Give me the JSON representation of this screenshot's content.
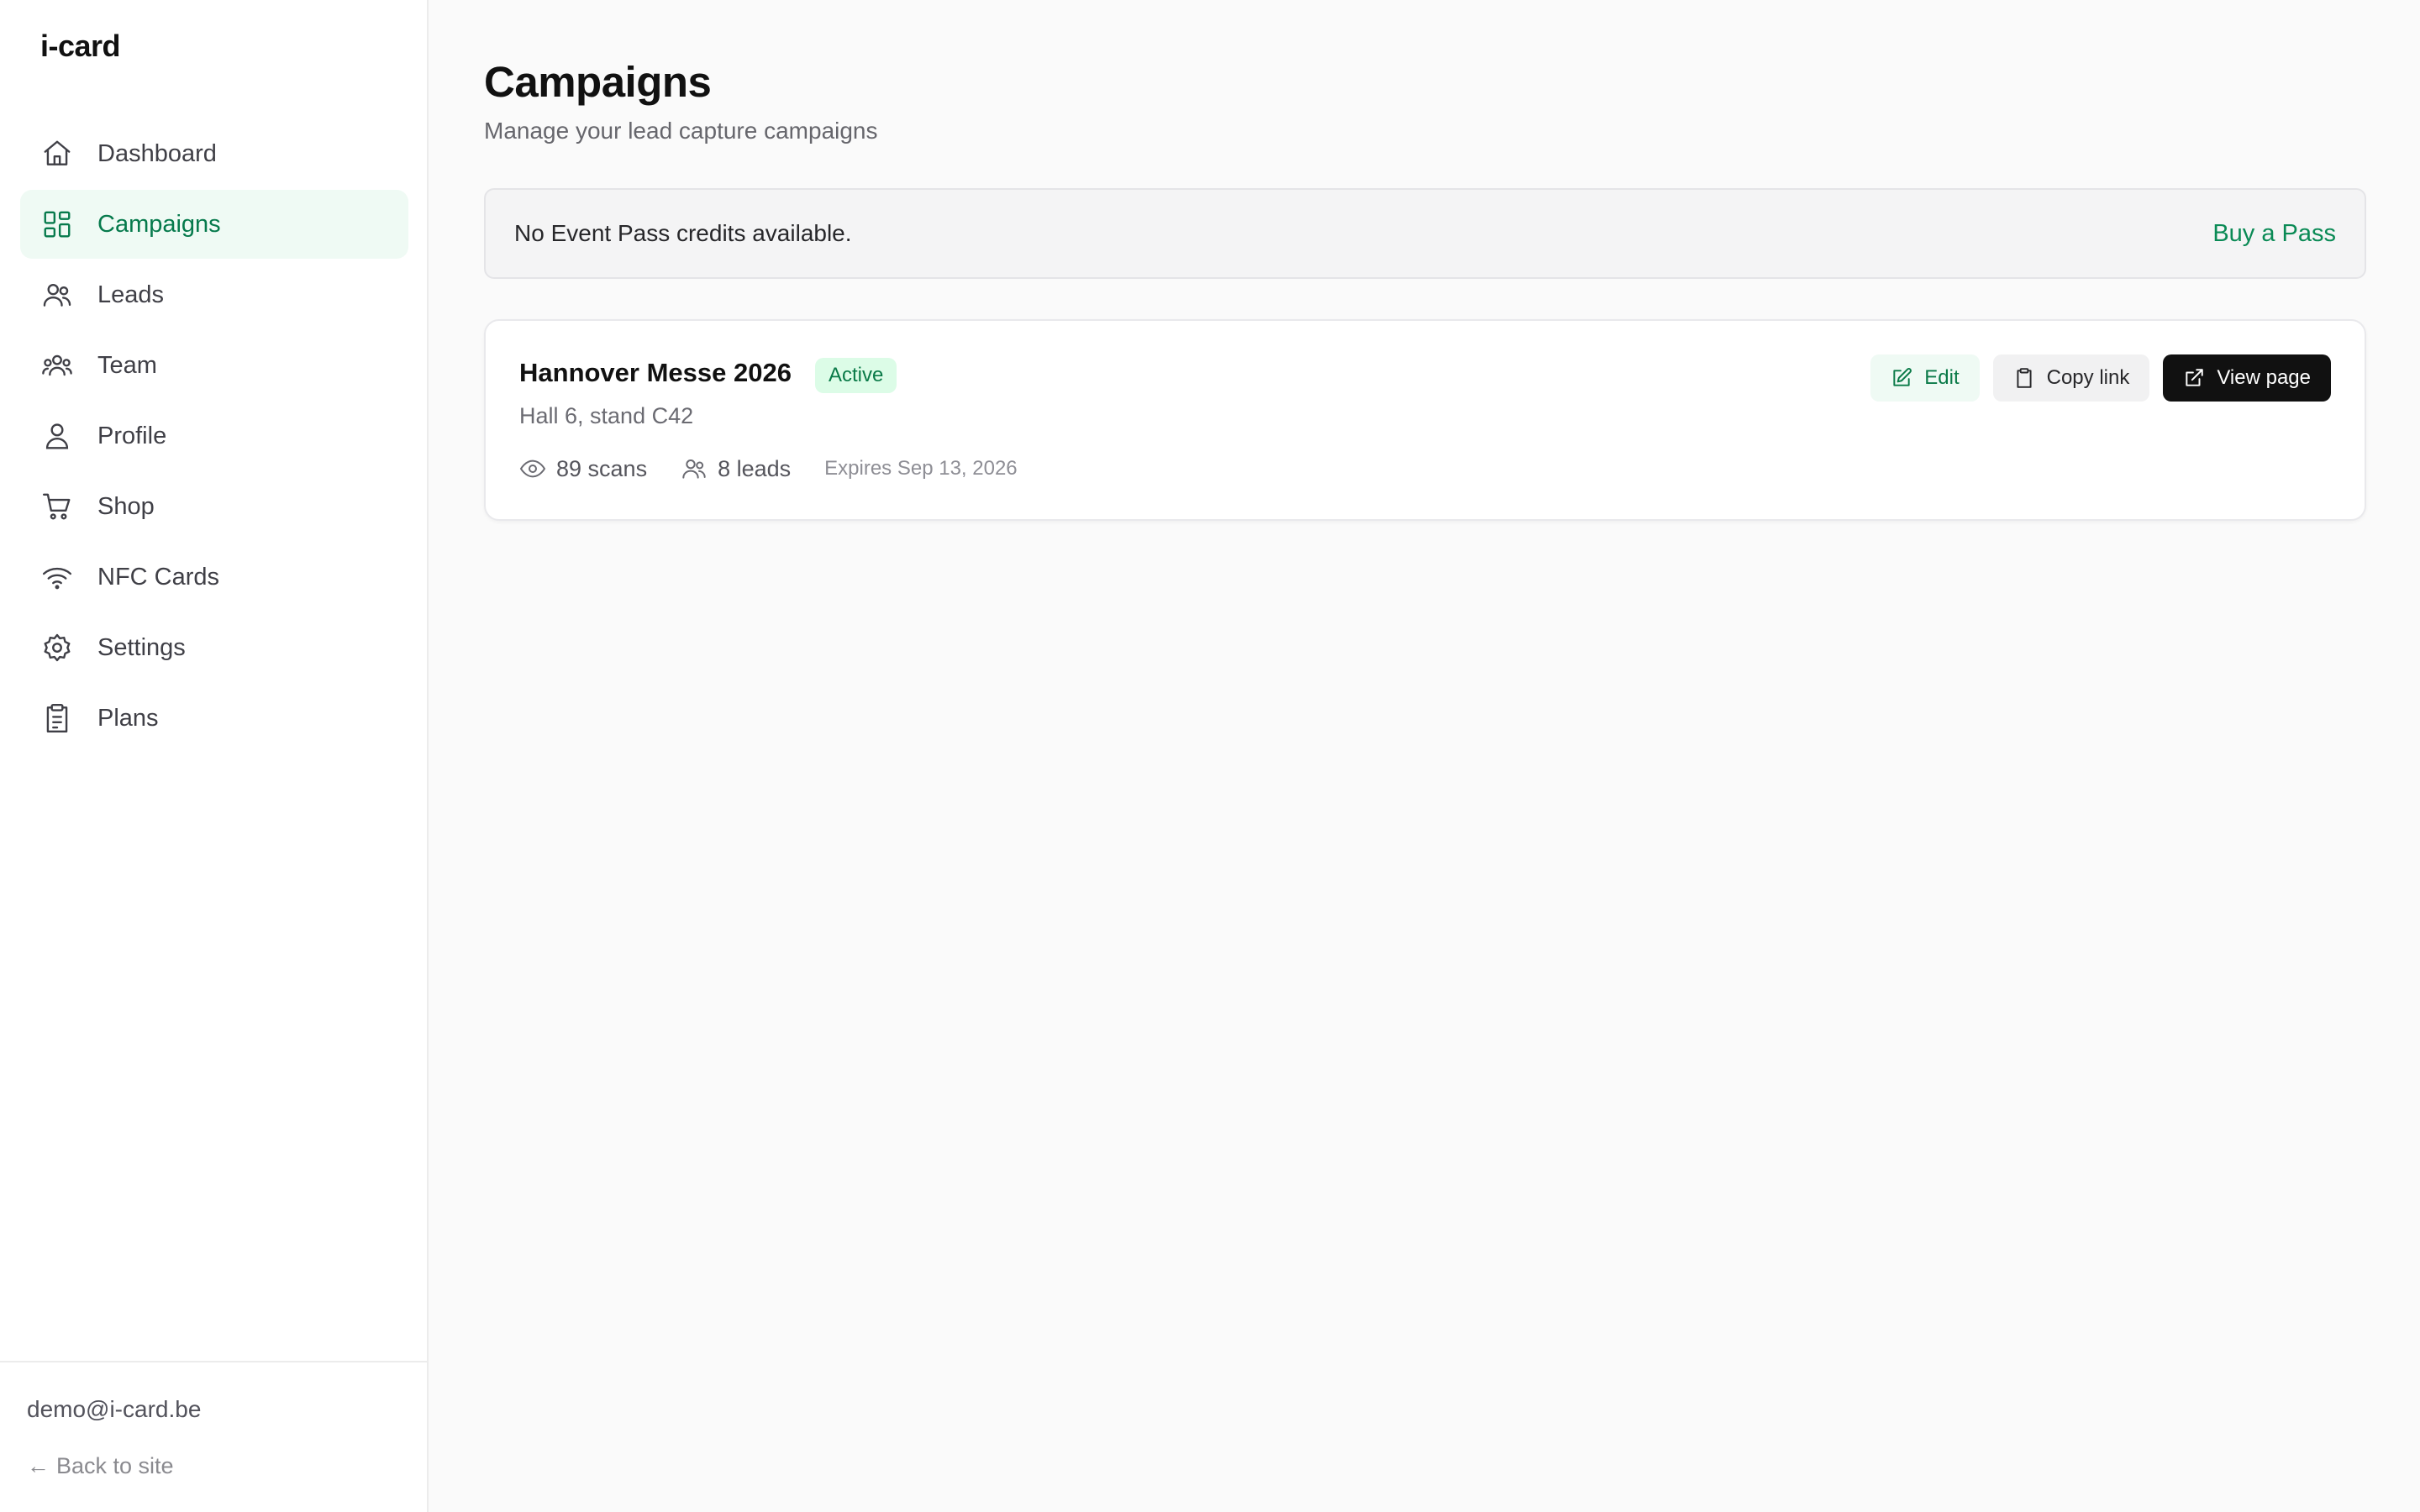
{
  "app": {
    "logo": "i-card"
  },
  "sidebar": {
    "items": [
      {
        "label": "Dashboard",
        "icon": "home-icon",
        "active": false
      },
      {
        "label": "Campaigns",
        "icon": "grid-icon",
        "active": true
      },
      {
        "label": "Leads",
        "icon": "users-icon",
        "active": false
      },
      {
        "label": "Team",
        "icon": "team-icon",
        "active": false
      },
      {
        "label": "Profile",
        "icon": "user-icon",
        "active": false
      },
      {
        "label": "Shop",
        "icon": "cart-icon",
        "active": false
      },
      {
        "label": "NFC Cards",
        "icon": "wifi-icon",
        "active": false
      },
      {
        "label": "Settings",
        "icon": "gear-icon",
        "active": false
      },
      {
        "label": "Plans",
        "icon": "clipboard-icon",
        "active": false
      }
    ],
    "footer": {
      "email": "demo@i-card.be",
      "back_label": "Back to site"
    }
  },
  "main": {
    "title": "Campaigns",
    "subtitle": "Manage your lead capture campaigns",
    "notice": {
      "text": "No Event Pass credits available.",
      "link_label": "Buy a Pass"
    },
    "campaigns": [
      {
        "name": "Hannover Messe 2026",
        "status": "Active",
        "location": "Hall 6, stand C42",
        "scans": "89 scans",
        "leads": "8 leads",
        "expires": "Expires Sep 13, 2026",
        "actions": {
          "edit": "Edit",
          "copy": "Copy link",
          "view": "View page"
        }
      }
    ]
  },
  "colors": {
    "accent": "#0a8a55",
    "active_bg": "#effaf4",
    "badge_bg": "#dcfce7",
    "primary_button": "#111111"
  }
}
